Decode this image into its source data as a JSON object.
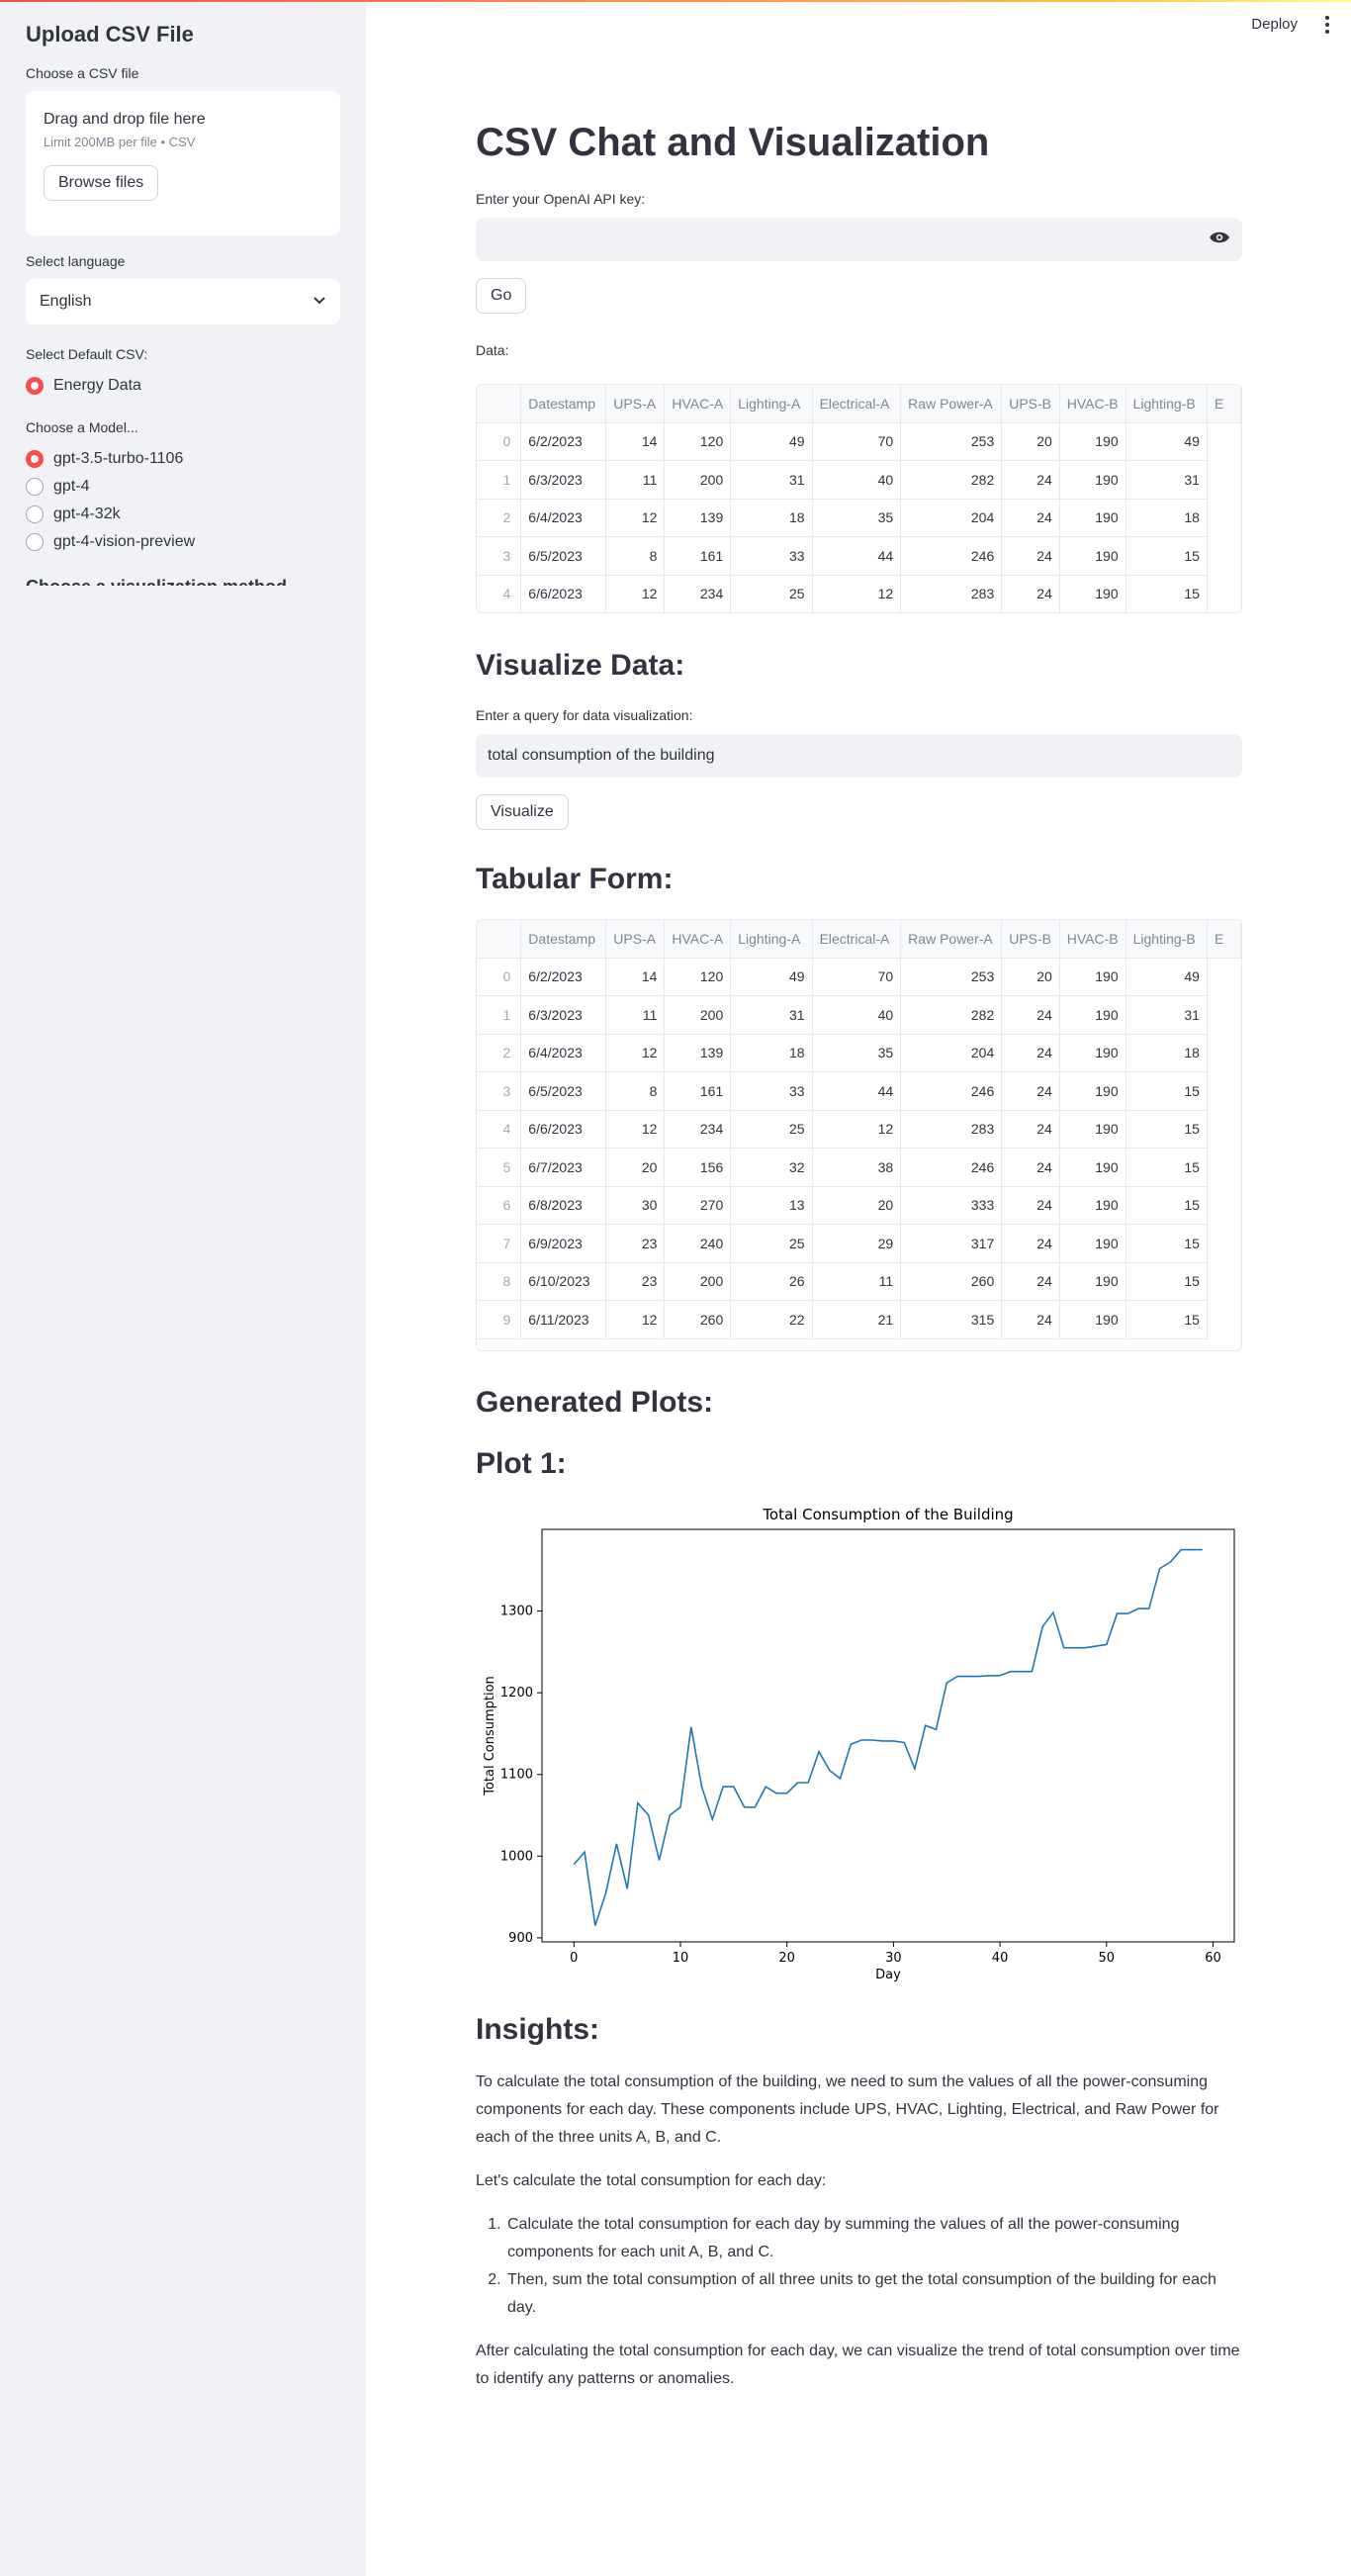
{
  "sidebar": {
    "title": "Upload CSV File",
    "choose_label": "Choose a CSV file",
    "uploader_main": "Drag and drop file here",
    "uploader_sub": "Limit 200MB per file • CSV",
    "browse_label": "Browse files",
    "language_label": "Select language",
    "language_value": "English",
    "default_csv_label": "Select Default CSV:",
    "default_csv_option": "Energy Data",
    "model_label": "Choose a Model...",
    "models": [
      "gpt-3.5-turbo-1106",
      "gpt-4",
      "gpt-4-32k",
      "gpt-4-vision-preview"
    ],
    "selected_model_index": 0,
    "cutoff_text": "Choose a visualization method"
  },
  "header": {
    "deploy_label": "Deploy"
  },
  "main": {
    "title": "CSV Chat and Visualization",
    "api_key_label": "Enter your OpenAI API key:",
    "api_key_value": "",
    "go_label": "Go",
    "data_label": "Data:",
    "visualize_heading": "Visualize Data:",
    "query_label": "Enter a query for data visualization:",
    "query_value": "total consumption of the building",
    "visualize_label": "Visualize",
    "tabular_heading": "Tabular Form:",
    "generated_heading": "Generated Plots:",
    "plot_heading": "Plot 1:",
    "insights_heading": "Insights:",
    "insights_p1": "To calculate the total consumption of the building, we need to sum the values of all the power-consuming components for each day. These components include UPS, HVAC, Lighting, Electrical, and Raw Power for each of the three units A, B, and C.",
    "insights_p2": "Let's calculate the total consumption for each day:",
    "insights_steps": [
      "Calculate the total consumption for each day by summing the values of all the power-consuming components for each unit A, B, and C.",
      "Then, sum the total consumption of all three units to get the total consumption of the building for each day."
    ],
    "insights_p3": "After calculating the total consumption for each day, we can visualize the trend of total consumption over time to identify any patterns or anomalies."
  },
  "table": {
    "columns": [
      "Datestamp",
      "UPS-A",
      "HVAC-A",
      "Lighting-A",
      "Electrical-A",
      "Raw Power-A",
      "UPS-B",
      "HVAC-B",
      "Lighting-B",
      "E"
    ],
    "rows": [
      [
        "0",
        "6/2/2023",
        "14",
        "120",
        "49",
        "70",
        "253",
        "20",
        "190",
        "49"
      ],
      [
        "1",
        "6/3/2023",
        "11",
        "200",
        "31",
        "40",
        "282",
        "24",
        "190",
        "31"
      ],
      [
        "2",
        "6/4/2023",
        "12",
        "139",
        "18",
        "35",
        "204",
        "24",
        "190",
        "18"
      ],
      [
        "3",
        "6/5/2023",
        "8",
        "161",
        "33",
        "44",
        "246",
        "24",
        "190",
        "15"
      ],
      [
        "4",
        "6/6/2023",
        "12",
        "234",
        "25",
        "12",
        "283",
        "24",
        "190",
        "15"
      ],
      [
        "5",
        "6/7/2023",
        "20",
        "156",
        "32",
        "38",
        "246",
        "24",
        "190",
        "15"
      ],
      [
        "6",
        "6/8/2023",
        "30",
        "270",
        "13",
        "20",
        "333",
        "24",
        "190",
        "15"
      ],
      [
        "7",
        "6/9/2023",
        "23",
        "240",
        "25",
        "29",
        "317",
        "24",
        "190",
        "15"
      ],
      [
        "8",
        "6/10/2023",
        "23",
        "200",
        "26",
        "11",
        "260",
        "24",
        "190",
        "15"
      ],
      [
        "9",
        "6/11/2023",
        "12",
        "260",
        "22",
        "21",
        "315",
        "24",
        "190",
        "15"
      ]
    ]
  },
  "chart_data": {
    "type": "line",
    "title": "Total Consumption of the Building",
    "xlabel": "Day",
    "ylabel": "Total Consumption",
    "xlim": [
      -3,
      62
    ],
    "ylim": [
      895,
      1400
    ],
    "xticks": [
      0,
      10,
      20,
      30,
      40,
      50,
      60
    ],
    "yticks": [
      900,
      1000,
      1100,
      1200,
      1300
    ],
    "series": [
      {
        "color": "#1f77b4",
        "x": [
          0,
          1,
          2,
          3,
          4,
          5,
          6,
          7,
          8,
          9,
          10,
          11,
          12,
          13,
          14,
          15,
          16,
          17,
          18,
          19,
          20,
          21,
          22,
          23,
          24,
          25,
          26,
          27,
          28,
          29,
          30,
          31,
          32,
          33,
          34,
          35,
          36,
          37,
          38,
          39,
          40,
          41,
          42,
          43,
          44,
          45,
          46,
          47,
          48,
          49,
          50,
          51,
          52,
          53,
          54,
          55,
          56,
          57,
          58,
          59
        ],
        "values": [
          990,
          1005,
          915,
          955,
          1015,
          960,
          1065,
          1050,
          995,
          1050,
          1060,
          1158,
          1085,
          1045,
          1085,
          1085,
          1060,
          1060,
          1085,
          1077,
          1077,
          1090,
          1090,
          1128,
          1105,
          1095,
          1137,
          1142,
          1142,
          1141,
          1141,
          1139,
          1107,
          1160,
          1155,
          1212,
          1220,
          1220,
          1220,
          1221,
          1221,
          1226,
          1226,
          1226,
          1281,
          1298,
          1255,
          1255,
          1255,
          1257,
          1259,
          1297,
          1297,
          1303,
          1303,
          1352,
          1360,
          1375,
          1375,
          1375
        ]
      }
    ]
  }
}
